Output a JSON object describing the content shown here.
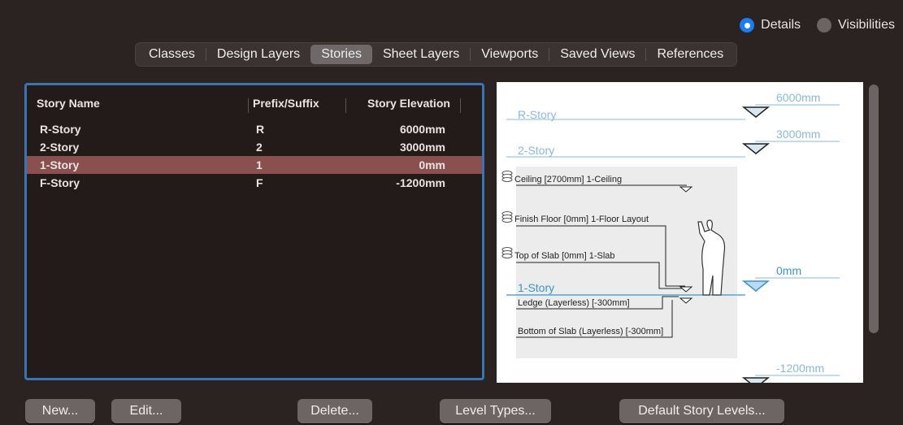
{
  "view_mode": {
    "options": [
      {
        "label": "Details",
        "selected": true
      },
      {
        "label": "Visibilities",
        "selected": false
      }
    ]
  },
  "tabs": [
    {
      "label": "Classes",
      "active": false
    },
    {
      "label": "Design Layers",
      "active": false
    },
    {
      "label": "Stories",
      "active": true
    },
    {
      "label": "Sheet Layers",
      "active": false
    },
    {
      "label": "Viewports",
      "active": false
    },
    {
      "label": "Saved Views",
      "active": false
    },
    {
      "label": "References",
      "active": false
    }
  ],
  "table": {
    "columns": [
      "Story Name",
      "Prefix/Suffix",
      "Story Elevation"
    ],
    "rows": [
      {
        "name": "R-Story",
        "prefix": "R",
        "elevation": "6000mm",
        "selected": false
      },
      {
        "name": "2-Story",
        "prefix": "2",
        "elevation": "3000mm",
        "selected": false
      },
      {
        "name": "1-Story",
        "prefix": "1",
        "elevation": "0mm",
        "selected": true
      },
      {
        "name": "F-Story",
        "prefix": "F",
        "elevation": "-1200mm",
        "selected": false
      }
    ]
  },
  "preview": {
    "stories": [
      {
        "name": "R-Story",
        "elevation": "6000mm"
      },
      {
        "name": "2-Story",
        "elevation": "3000mm"
      },
      {
        "name": "1-Story",
        "elevation": "0mm"
      },
      {
        "name": "",
        "elevation": "-1200mm"
      }
    ],
    "levels": [
      "Ceiling [2700mm] 1-Ceiling",
      "Finish Floor [0mm] 1-Floor Layout",
      "Top of Slab [0mm] 1-Slab",
      "Ledge (Layerless) [-300mm]",
      "Bottom of Slab (Layerless) [-300mm]"
    ]
  },
  "buttons": {
    "new": "New...",
    "edit": "Edit...",
    "delete": "Delete...",
    "level_types": "Level Types...",
    "default_story_levels": "Default Story Levels..."
  },
  "colors": {
    "accent": "#1e7cf2",
    "selection": "#8a4f4f",
    "panel_border": "#3b74b4",
    "story_line": "#8ab9d9"
  }
}
